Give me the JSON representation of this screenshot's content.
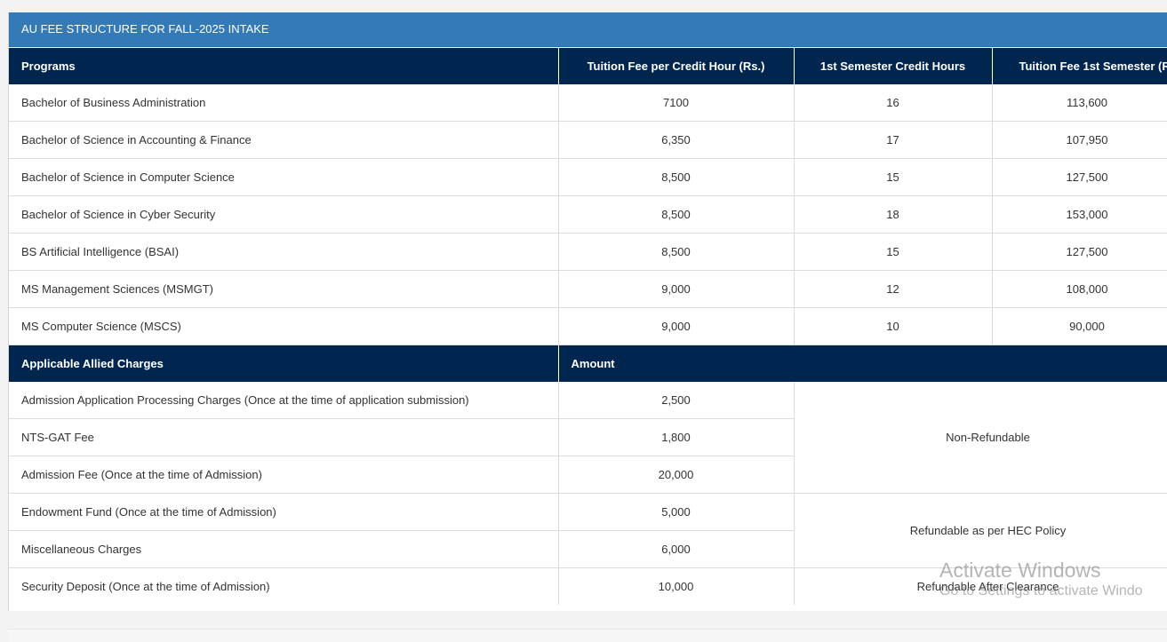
{
  "panel_title": "AU FEE STRUCTURE FOR FALL-2025 INTAKE",
  "program_table": {
    "headers": [
      "Programs",
      "Tuition Fee per Credit Hour (Rs.)",
      "1st Semester Credit Hours",
      "Tuition Fee 1st Semester (R"
    ],
    "rows": [
      [
        "Bachelor of Business Administration",
        "7100",
        "16",
        "113,600"
      ],
      [
        "Bachelor of Science in Accounting & Finance",
        "6,350",
        "17",
        "107,950"
      ],
      [
        "Bachelor of Science in Computer Science",
        "8,500",
        "15",
        "127,500"
      ],
      [
        "Bachelor of Science in Cyber Security",
        "8,500",
        "18",
        "153,000"
      ],
      [
        "BS Artificial Intelligence (BSAI)",
        "8,500",
        "15",
        "127,500"
      ],
      [
        "MS Management Sciences (MSMGT)",
        "9,000",
        "12",
        "108,000"
      ],
      [
        "MS Computer Science (MSCS)",
        "9,000",
        "10",
        "90,000"
      ]
    ]
  },
  "charges_table": {
    "headers": [
      "Applicable Allied Charges",
      "Amount"
    ],
    "rows": [
      [
        "Admission Application Processing Charges (Once at the time of application submission)",
        "2,500"
      ],
      [
        "NTS-GAT Fee",
        "1,800"
      ],
      [
        "Admission Fee (Once at the time of Admission)",
        "20,000"
      ],
      [
        "Endowment Fund (Once at the time of Admission)",
        "5,000"
      ],
      [
        "Miscellaneous Charges",
        "6,000"
      ],
      [
        "Security Deposit (Once at the time of Admission)",
        "10,000"
      ]
    ],
    "notes": {
      "non_refundable": "Non-Refundable",
      "refundable_hec": "Refundable as per HEC Policy",
      "refundable_clearance": "Refundable After Clearance"
    }
  },
  "watermark": {
    "title": "Activate Windows",
    "subtitle": "Go to Settings to activate Windo"
  }
}
